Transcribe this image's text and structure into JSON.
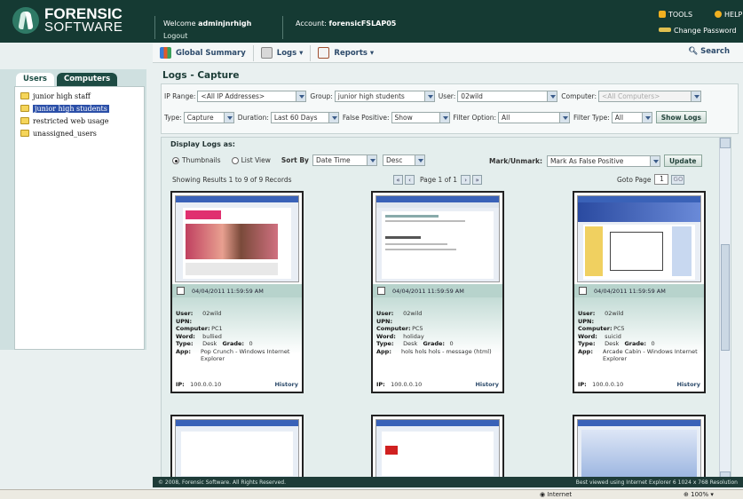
{
  "brand": {
    "line1": "FORENSIC",
    "line2": "SOFTWARE"
  },
  "header": {
    "welcome_prefix": "Welcome ",
    "username": "adminjnrhigh",
    "logout": "Logout",
    "account_prefix": "Account: ",
    "account": "forensicFSLAP05",
    "tools": "TOOLS",
    "help": "HELP",
    "change_password": "Change Password"
  },
  "toolbar": {
    "global_summary": "Global Summary",
    "logs": "Logs ▾",
    "reports": "Reports ▾",
    "search": "Search"
  },
  "sidebar": {
    "tabs": [
      "Users",
      "Computers"
    ],
    "items": [
      "junior high staff",
      "junior high students",
      "restricted web usage",
      "unassigned_users"
    ],
    "selected_index": 1
  },
  "page": {
    "title": "Logs - Capture"
  },
  "filters": {
    "ip_range_label": "IP Range:",
    "ip_range": "<All IP Addresses>",
    "group_label": "Group:",
    "group": "junior high students",
    "user_label": "User:",
    "user": "02wild",
    "computer_label": "Computer:",
    "computer": "<All Computers>",
    "type_label": "Type:",
    "type": "Capture",
    "duration_label": "Duration:",
    "duration": "Last 60 Days",
    "false_positive_label": "False Positive:",
    "false_positive": "Show",
    "filter_option_label": "Filter Option:",
    "filter_option": "All",
    "filter_type_label": "Filter Type:",
    "filter_type": "All",
    "show_logs": "Show Logs"
  },
  "display": {
    "heading": "Display Logs as:",
    "thumbnails": "Thumbnails",
    "list_view": "List View",
    "sort_by_label": "Sort By",
    "sort_by": "Date Time",
    "order": "Desc",
    "mark_label": "Mark/Unmark:",
    "mark_value": "Mark As False Positive",
    "update": "Update",
    "results": "Showing Results 1 to 9 of 9 Records",
    "page_info": "Page 1 of 1",
    "goto_label": "Goto Page",
    "goto_value": "1",
    "go": "GO"
  },
  "labels": {
    "user": "User:",
    "upn": "UPN:",
    "computer": "Computer:",
    "word": "Word:",
    "type": "Type:",
    "grade": "Grade:",
    "app": "App:",
    "ip": "IP:",
    "history": "History"
  },
  "records": [
    {
      "datetime": "04/04/2011 11:59:59 AM",
      "user": "02wild",
      "computer": "PC1",
      "word": "bullied",
      "type": "Desk",
      "grade": "0",
      "app": "Pop Crunch - Windows Internet Explorer",
      "ip": "100.0.0.10"
    },
    {
      "datetime": "04/04/2011 11:59:59 AM",
      "user": "02wild",
      "computer": "PC5",
      "word": "holiday",
      "type": "Desk",
      "grade": "0",
      "app": "hols hols hols - message (html)",
      "ip": "100.0.0.10"
    },
    {
      "datetime": "04/04/2011 11:59:59 AM",
      "user": "02wild",
      "computer": "PC5",
      "word": "suicid",
      "type": "Desk",
      "grade": "0",
      "app": "Arcade Cabin - Windows Internet Explorer",
      "ip": "100.0.0.10"
    }
  ],
  "footer": {
    "copyright": "© 2008, Forensic Software. All Rights Reserved.",
    "best_viewed": "Best viewed using Internet Explorer 6 1024 x 768 Resolution"
  },
  "statusbar": {
    "zone": "Internet",
    "zoom": "100%"
  },
  "colors": {
    "header_bg": "#153a33",
    "accent": "#b7d3cc"
  }
}
